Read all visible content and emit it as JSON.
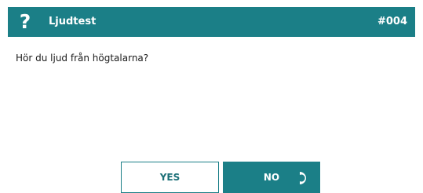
{
  "dialog": {
    "title": "Ljudtest",
    "code": "#004",
    "question": "Hör du ljud från högtalarna?",
    "icon": "question-icon"
  },
  "buttons": {
    "yes_label": "YES",
    "no_label": "NO"
  },
  "colors": {
    "accent": "#1b7f87",
    "text": "#1a1a1a",
    "background": "#ffffff"
  }
}
